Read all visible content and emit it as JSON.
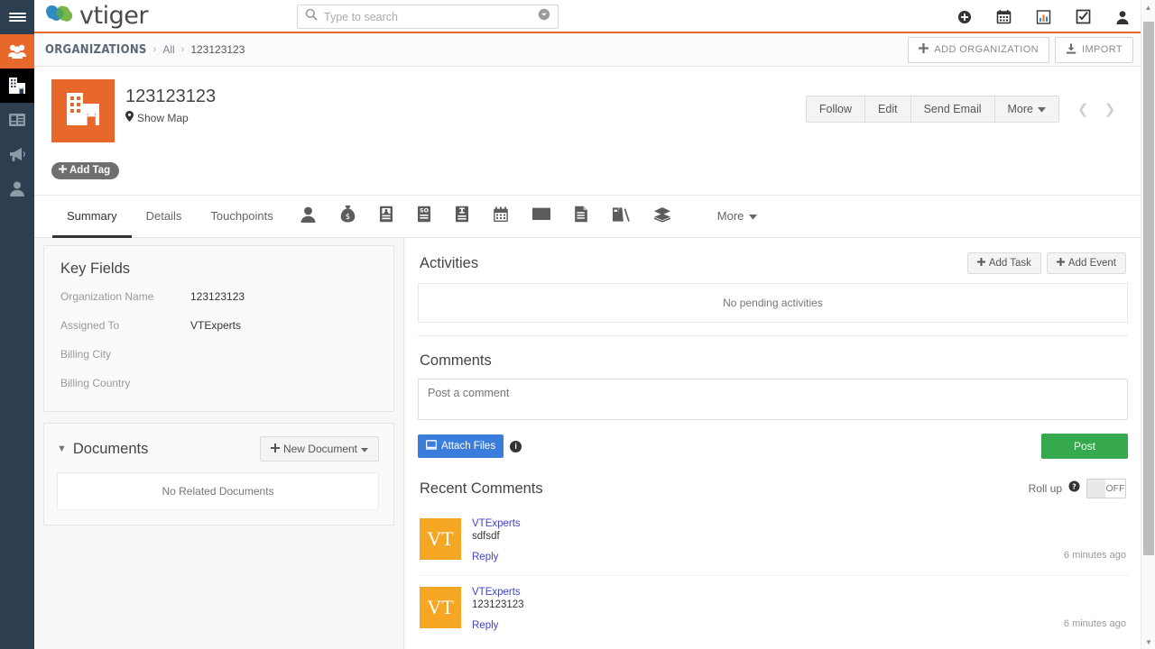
{
  "brand": {
    "name": "vtiger",
    "accent": "#e8682c",
    "rail_bg": "#2c3e50"
  },
  "topbar": {
    "menu_icon": "hamburger-icon",
    "search": {
      "placeholder": "Type to search",
      "value": "",
      "icon": "search-icon",
      "dropdown_icon": "chevron-down-circle-icon"
    },
    "icons": [
      {
        "name": "add-circle-icon",
        "label": "Add"
      },
      {
        "name": "calendar-icon",
        "label": "Calendar"
      },
      {
        "name": "bar-chart-icon",
        "label": "Reports"
      },
      {
        "name": "checkbox-task-icon",
        "label": "Tasks"
      },
      {
        "name": "user-account-icon",
        "label": "Account"
      }
    ]
  },
  "rail": {
    "items": [
      {
        "name": "sidebar-item-contacts",
        "icon": "people-group-icon",
        "state": "orange"
      },
      {
        "name": "sidebar-item-organizations",
        "icon": "building-icon",
        "state": "black"
      },
      {
        "name": "sidebar-item-inventory",
        "icon": "id-card-icon",
        "state": "normal"
      },
      {
        "name": "sidebar-item-marketing",
        "icon": "megaphone-icon",
        "state": "normal"
      },
      {
        "name": "sidebar-item-user",
        "icon": "person-icon",
        "state": "normal"
      }
    ]
  },
  "breadcrumb": {
    "module": "ORGANIZATIONS",
    "sep": "›",
    "list": "All",
    "current": "123123123",
    "add_label": "ADD ORGANIZATION",
    "import_label": "IMPORT"
  },
  "record": {
    "title": "123123123",
    "show_map": "Show Map",
    "add_tag": "Add Tag",
    "avatar_icon": "building-icon",
    "actions": [
      "Follow",
      "Edit",
      "Send Email"
    ],
    "more_label": "More",
    "prev_icon": "chevron-left-icon",
    "next_icon": "chevron-right-icon"
  },
  "tabs": {
    "text_tabs": [
      {
        "label": "Summary",
        "active": true
      },
      {
        "label": "Details",
        "active": false
      },
      {
        "label": "Touchpoints",
        "active": false
      }
    ],
    "icon_tabs": [
      {
        "name": "tab-contacts",
        "icon": "person-icon"
      },
      {
        "name": "tab-opportunities",
        "icon": "money-bag-icon"
      },
      {
        "name": "tab-quotes",
        "icon": "quote-document-icon"
      },
      {
        "name": "tab-sales-orders",
        "icon": "sales-order-icon"
      },
      {
        "name": "tab-invoices",
        "icon": "invoice-icon"
      },
      {
        "name": "tab-events",
        "icon": "calendar-icon"
      },
      {
        "name": "tab-emails",
        "icon": "envelope-icon"
      },
      {
        "name": "tab-documents",
        "icon": "document-icon"
      },
      {
        "name": "tab-files",
        "icon": "files-icon"
      },
      {
        "name": "tab-products",
        "icon": "package-box-icon"
      }
    ],
    "more_label": "More"
  },
  "key_fields": {
    "title": "Key Fields",
    "rows": [
      {
        "label": "Organization Name",
        "value": "123123123"
      },
      {
        "label": "Assigned To",
        "value": "VTExperts"
      },
      {
        "label": "Billing City",
        "value": ""
      },
      {
        "label": "Billing Country",
        "value": ""
      }
    ]
  },
  "documents": {
    "title": "Documents",
    "collapse_icon": "chevron-down-icon",
    "new_label": "New Document",
    "empty": "No Related Documents"
  },
  "activities": {
    "title": "Activities",
    "add_task": "Add Task",
    "add_event": "Add Event",
    "empty": "No pending activities"
  },
  "comments": {
    "title": "Comments",
    "placeholder": "Post a comment",
    "value": "",
    "attach_label": "Attach Files",
    "info_icon": "info-icon",
    "post_label": "Post"
  },
  "recent_comments": {
    "title": "Recent Comments",
    "rollup_label": "Roll up",
    "rollup_help_icon": "help-circle-icon",
    "rollup_state": "OFF",
    "items": [
      {
        "initials": "VT",
        "user": "VTExperts",
        "text": "sdfsdf",
        "reply": "Reply",
        "time": "6 minutes ago"
      },
      {
        "initials": "VT",
        "user": "VTExperts",
        "text": "123123123",
        "reply": "Reply",
        "time": "6 minutes ago"
      }
    ]
  },
  "scrollbar": {
    "up_icon": "triangle-up-icon",
    "down_icon": "triangle-down-icon"
  }
}
